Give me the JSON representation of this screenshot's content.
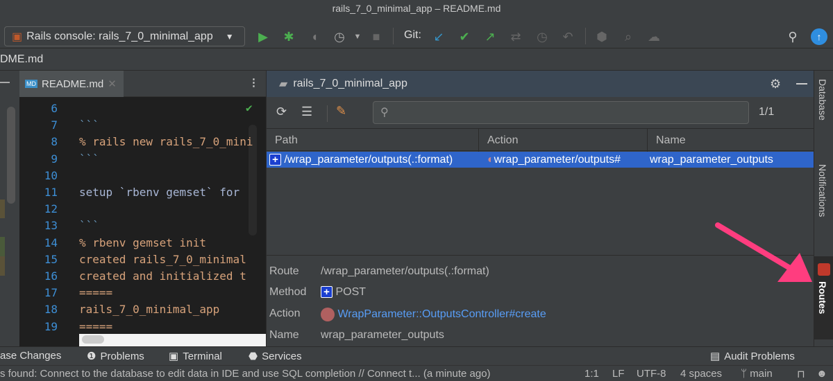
{
  "title": "rails_7_0_minimal_app – README.md",
  "toolbar": {
    "run_config": "Rails console: rails_7_0_minimal_app",
    "git_label": "Git:"
  },
  "navbar": {
    "crumb": "DME.md"
  },
  "editor": {
    "tab": "README.md",
    "file_badge": "MD",
    "lines": [
      {
        "n": "6",
        "t": ""
      },
      {
        "n": "7",
        "t": "```"
      },
      {
        "n": "8",
        "t": "% rails new rails_7_0_mini"
      },
      {
        "n": "9",
        "t": "```"
      },
      {
        "n": "10",
        "t": ""
      },
      {
        "n": "11",
        "t": "setup `rbenv gemset` for"
      },
      {
        "n": "12",
        "t": ""
      },
      {
        "n": "13",
        "t": "```"
      },
      {
        "n": "14",
        "t": "% rbenv gemset init"
      },
      {
        "n": "15",
        "t": "created rails_7_0_minimal"
      },
      {
        "n": "16",
        "t": "created and initialized t"
      },
      {
        "n": "17",
        "t": "====="
      },
      {
        "n": "18",
        "t": "rails_7_0_minimal_app"
      },
      {
        "n": "19",
        "t": "====="
      }
    ]
  },
  "routes": {
    "header": "rails_7_0_minimal_app",
    "count": "1/1",
    "search_placeholder": "",
    "columns": [
      "Path",
      "Action",
      "Name"
    ],
    "rows": [
      {
        "path": "/wrap_parameter/outputs(.:format)",
        "action": "wrap_parameter/outputs#",
        "name": "wrap_parameter_outputs"
      }
    ],
    "details": {
      "route_label": "Route",
      "route": "/wrap_parameter/outputs(.:format)",
      "method_label": "Method",
      "method": "POST",
      "action_label": "Action",
      "action": "WrapParameter::OutputsController#create",
      "name_label": "Name",
      "name": "wrap_parameter_outputs"
    }
  },
  "right_strip": {
    "database": "Database",
    "notifications": "Notifications",
    "routes": "Routes"
  },
  "bottom": {
    "db_changes": "ase Changes",
    "problems": "Problems",
    "terminal": "Terminal",
    "services": "Services",
    "audit": "Audit Problems"
  },
  "status": {
    "message": "s found: Connect to the database to edit data in IDE and use SQL completion // Connect t... (a minute ago)",
    "position": "1:1",
    "line_sep": "LF",
    "encoding": "UTF-8",
    "indent": "4 spaces",
    "branch": "main"
  },
  "colors": {
    "selection": "#2f65ca",
    "link": "#589df6",
    "arrow": "#ff3d7f"
  }
}
